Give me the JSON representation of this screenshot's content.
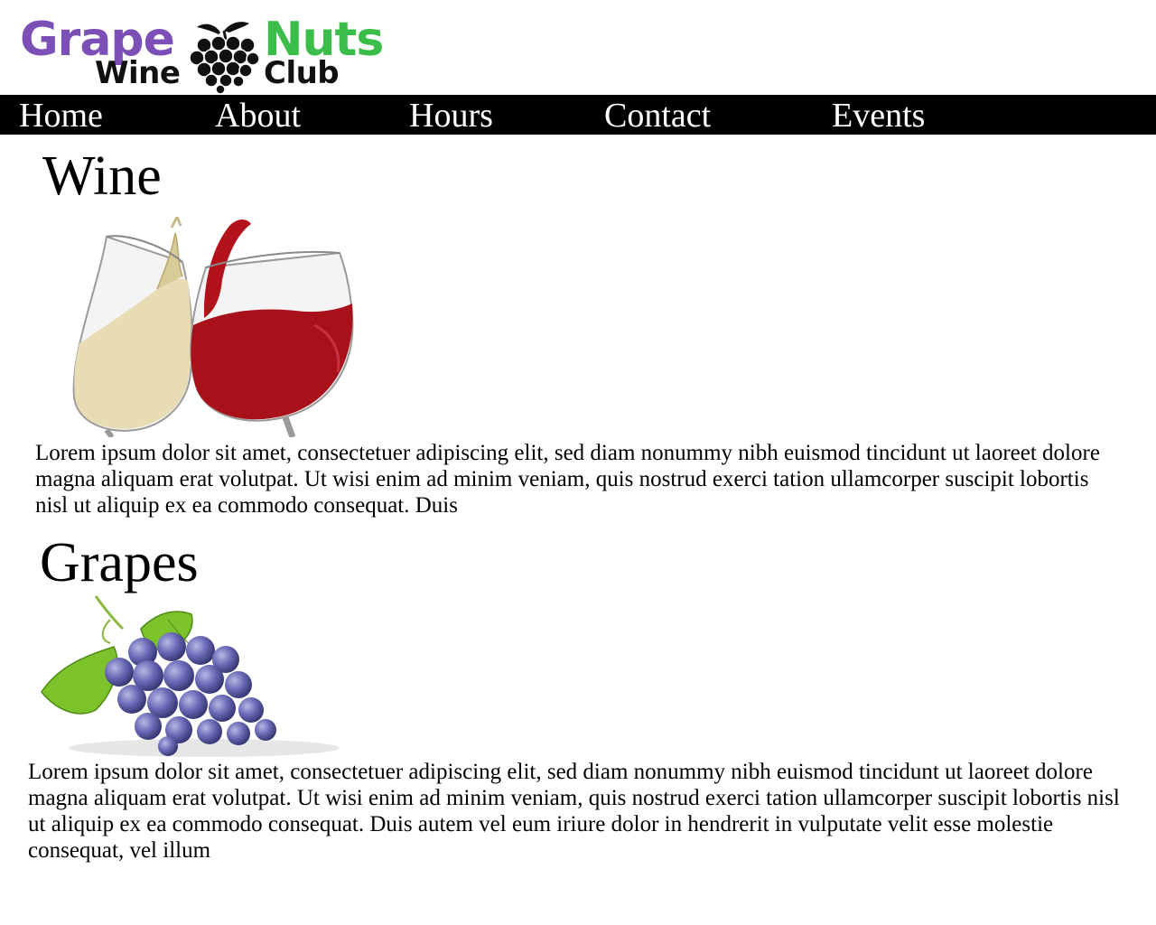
{
  "logo": {
    "line1_left": "Grape",
    "line1_right": "Nuts",
    "line2_left": "Wine",
    "line2_right": "Club",
    "icon": "grape-cluster-icon"
  },
  "colors": {
    "grape_purple": "#7b4fb6",
    "nuts_green": "#3bbd4a",
    "nav_background": "#000000",
    "nav_text": "#ffffff",
    "white_wine": "#e8dcb4",
    "red_wine": "#a8101a",
    "grape_berry": "#5a5aa8",
    "grape_leaf": "#7cc22a"
  },
  "nav": {
    "items": [
      {
        "label": "Home"
      },
      {
        "label": "About"
      },
      {
        "label": "Hours"
      },
      {
        "label": "Contact"
      },
      {
        "label": "Events"
      }
    ]
  },
  "sections": [
    {
      "title": "Wine",
      "image": "wine-glasses-toast-image",
      "body": "Lorem ipsum dolor sit amet, consectetuer adipiscing elit, sed diam nonummy nibh euismod tincidunt ut laoreet dolore magna aliquam erat volutpat. Ut wisi enim ad minim veniam, quis nostrud exerci tation ullamcorper suscipit lobortis nisl ut aliquip ex ea commodo consequat. Duis"
    },
    {
      "title": "Grapes",
      "image": "grape-bunch-image",
      "body": "Lorem ipsum dolor sit amet, consectetuer adipiscing elit, sed diam nonummy nibh euismod tincidunt ut laoreet dolore magna aliquam erat volutpat. Ut wisi enim ad minim veniam, quis nostrud exerci tation ullamcorper suscipit lobortis nisl ut aliquip ex ea commodo consequat. Duis autem vel eum iriure dolor in hendrerit in vulputate velit esse molestie consequat, vel illum"
    }
  ]
}
